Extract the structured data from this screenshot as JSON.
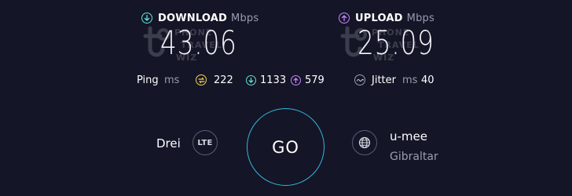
{
  "download": {
    "label": "DOWNLOAD",
    "unit": "Mbps",
    "value": "43.06",
    "icon": "arrow-down-icon",
    "color": "#62e3d9"
  },
  "upload": {
    "label": "UPLOAD",
    "unit": "Mbps",
    "value": "25.09",
    "icon": "arrow-up-icon",
    "color": "#c487ff"
  },
  "ping": {
    "label": "Ping",
    "unit": "ms",
    "idle": "222",
    "download": "1133",
    "upload": "579",
    "idle_color": "#f3d35b"
  },
  "jitter": {
    "label": "Jitter",
    "unit": "ms",
    "value": "40"
  },
  "provider": {
    "name": "Drei",
    "network": "LTE"
  },
  "go_label": "GO",
  "server": {
    "name": "u-mee",
    "location": "Gibraltar"
  },
  "watermark": {
    "line1": "PHONE",
    "line2": "TRAVEL",
    "line3": "WIZ"
  }
}
